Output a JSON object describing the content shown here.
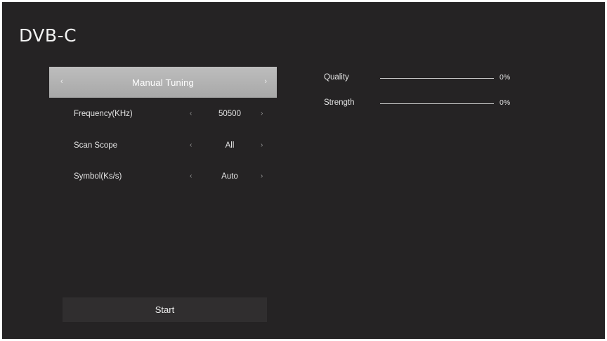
{
  "screen": {
    "title": "DVB-C"
  },
  "menu": {
    "header": {
      "label": "Manual Tuning",
      "left_icon": "chevron-left-icon",
      "right_icon": "chevron-right-icon",
      "left_glyph": "‹",
      "right_glyph": "›"
    },
    "rows": [
      {
        "label": "Frequency(KHz)",
        "value": "50500",
        "left_glyph": "‹",
        "right_glyph": "›"
      },
      {
        "label": "Scan Scope",
        "value": "All",
        "left_glyph": "‹",
        "right_glyph": "›"
      },
      {
        "label": "Symbol(Ks/s)",
        "value": "Auto",
        "left_glyph": "‹",
        "right_glyph": "›"
      }
    ]
  },
  "start_button": {
    "label": "Start"
  },
  "signal": {
    "quality": {
      "label": "Quality",
      "value_text": "0%",
      "fraction": 0
    },
    "strength": {
      "label": "Strength",
      "value_text": "0%",
      "fraction": 0
    }
  },
  "colors": {
    "background": "#252324",
    "header_highlight": "#b4b4b4",
    "text": "#e4e4e4",
    "button": "#302e2f"
  }
}
